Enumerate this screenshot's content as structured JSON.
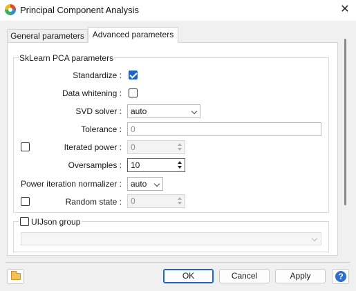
{
  "window": {
    "title": "Principal Component Analysis",
    "close_glyph": "✕",
    "icon": "app-logo-icon"
  },
  "tabs": [
    {
      "label": "General parameters",
      "selected": false
    },
    {
      "label": "Advanced parameters",
      "selected": true
    }
  ],
  "sklearn_group": {
    "title": "SkLearn PCA parameters",
    "standardize": {
      "label": "Standardize :",
      "checked": true
    },
    "whitening": {
      "label": "Data whitening :",
      "checked": false
    },
    "svd_solver": {
      "label": "SVD solver :",
      "value": "auto"
    },
    "tolerance": {
      "label": "Tolerance :",
      "placeholder": "0"
    },
    "iterated_power": {
      "label": "Iterated power :",
      "value": "0",
      "enabled": false
    },
    "oversamples": {
      "label": "Oversamples :",
      "value": "10"
    },
    "power_iteration_normalizer": {
      "label": "Power iteration normalizer :",
      "value": "auto"
    },
    "random_state": {
      "label": "Random state :",
      "value": "0",
      "enabled": false
    }
  },
  "uijson_group": {
    "label": "UIJson group",
    "checked": false,
    "value": ""
  },
  "footer": {
    "ok_label": "OK",
    "cancel_label": "Cancel",
    "apply_label": "Apply",
    "help_glyph": "?",
    "folder_icon": "folder-icon"
  },
  "colors": {
    "accent": "#1f66c1",
    "background": "#f0f0f0",
    "pane": "#ffffff"
  }
}
